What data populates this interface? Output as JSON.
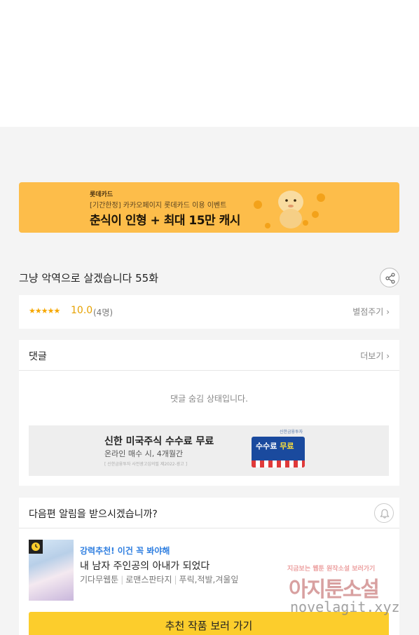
{
  "banner": {
    "brand": "롯데카드",
    "subtitle": "[기간한정] 카카오페이지 롯데카드 이용 이벤트",
    "headline": "춘식이 인형 + 최대 15만 캐시"
  },
  "episode": {
    "title": "그냥 악역으로 살겠습니다 55화"
  },
  "rating": {
    "stars": "★★★★★",
    "value": "10.0",
    "count": "(4명)",
    "rate_link": "별점주기"
  },
  "comments": {
    "header": "댓글",
    "more": "더보기",
    "hidden_message": "댓글 숨김 상태입니다."
  },
  "ad": {
    "title": "신한 미국주식 수수료 무료",
    "subtitle": "온라인 매수 시, 4개월간",
    "fine_print": "[ 신한금융투자 사전광고심의필 제2022-광고 ]",
    "brand": "신한금융투자",
    "badge_prefix": "수수료",
    "badge_free": "무료"
  },
  "notify": {
    "question": "다음편 알림을 받으시겠습니까?"
  },
  "recommendation": {
    "tag": "강력추천! 이건 꼭 봐야해",
    "title": "내 남자 주인공의 아내가 되었다",
    "meta": [
      "기다무웹툰",
      "로맨스판타지",
      "푸릭,적발,겨울잎"
    ],
    "button": "추천 작품 보러 가기"
  },
  "watermark": {
    "top": "지금보는 웹툰 원작소설 보러가기",
    "main": "아지툰소설",
    "url": "novelagit.xyz"
  },
  "colors": {
    "banner_bg": "#fdbd4a",
    "button_bg": "#fccd2c",
    "rating": "#e6a100",
    "tag_blue": "#2e7ee0"
  }
}
